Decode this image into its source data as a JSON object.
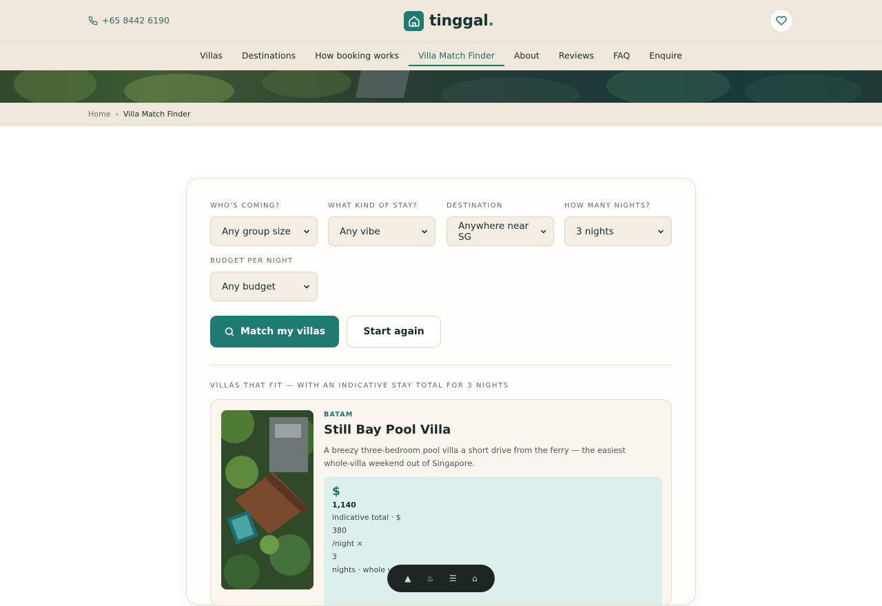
{
  "header": {
    "phone": "+65 8442 6190",
    "brand": "tinggal",
    "brand_dot": ".",
    "icons": {
      "phone": "phone-icon",
      "logo": "house-icon",
      "favourites": "heart-icon"
    }
  },
  "nav": {
    "items": [
      {
        "label": "Villas"
      },
      {
        "label": "Destinations"
      },
      {
        "label": "How booking works"
      },
      {
        "label": "Villa Match Finder",
        "active": true
      },
      {
        "label": "About"
      },
      {
        "label": "Reviews"
      },
      {
        "label": "FAQ"
      },
      {
        "label": "Enquire"
      }
    ]
  },
  "breadcrumb": {
    "home": "Home",
    "separator": "›",
    "current": "Villa Match Finder"
  },
  "finder": {
    "fields": [
      {
        "label": "WHO'S COMING?",
        "value": "Any group size"
      },
      {
        "label": "WHAT KIND OF STAY?",
        "value": "Any vibe"
      },
      {
        "label": "DESTINATION",
        "value": "Anywhere near SG"
      },
      {
        "label": "HOW MANY NIGHTS?",
        "value": "3 nights"
      },
      {
        "label": "BUDGET PER NIGHT",
        "value": "Any budget"
      }
    ],
    "match_button": "Match my villas",
    "reset_button": "Start again"
  },
  "results": {
    "heading": "VILLAS THAT FIT — WITH AN INDICATIVE STAY TOTAL FOR 3 NIGHTS",
    "villas": [
      {
        "region": "BATAM",
        "name": "Still Bay Pool Villa",
        "description": "A breezy three-bedroom pool villa a short drive from the ferry — the easiest whole-villa weekend out of Singapore.",
        "price": {
          "currency": "$",
          "total": "1,140",
          "line_total_label": "indicative total · $",
          "per_night": "380",
          "per_night_suffix": "/night ×",
          "nights": "3",
          "tail": "nights · whole vil"
        }
      }
    ]
  },
  "colors": {
    "accent": "#1f7a72",
    "sand": "#efe7da",
    "mint": "#dcefea"
  }
}
